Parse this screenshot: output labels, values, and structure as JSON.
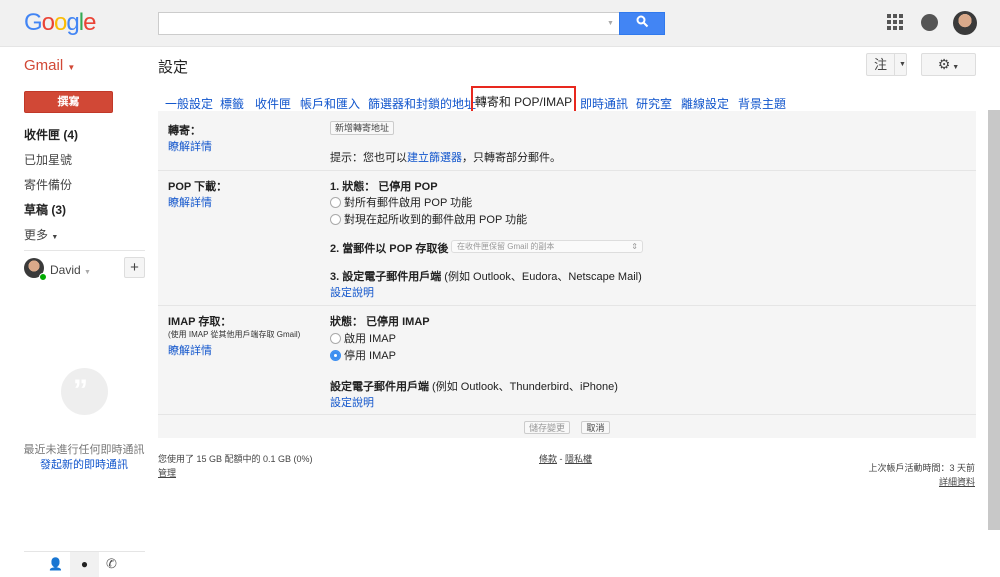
{
  "header": {
    "logo": "Google",
    "search_placeholder": "",
    "apps_icon": "apps-grid-icon",
    "notifications_icon": "bell-icon"
  },
  "subheader": {
    "app": "Gmail",
    "title": "設定",
    "input_tool": "注",
    "settings_icon": "gear-icon"
  },
  "sidebar": {
    "compose": "撰寫",
    "items": [
      {
        "label": "收件匣 (4)",
        "bold": true
      },
      {
        "label": "已加星號"
      },
      {
        "label": "寄件備份"
      },
      {
        "label": "草稿 (3)",
        "bold": true
      },
      {
        "label": "更多"
      }
    ],
    "user": "David",
    "hangouts_empty": "最近未進行任何即時通訊",
    "hangouts_start": "發起新的即時通訊"
  },
  "tabs": [
    "一般設定",
    "標籤",
    "收件匣",
    "帳戶和匯入",
    "篩選器和封鎖的地址",
    "轉寄和 POP/IMAP",
    "即時通訊",
    "研究室",
    "離線設定",
    "背景主題"
  ],
  "forwarding": {
    "label": "轉寄：",
    "learn": "瞭解詳情",
    "add_button": "新增轉寄地址",
    "tip_prefix": "提示：您也可以",
    "tip_link": "建立篩選器",
    "tip_suffix": "，只轉寄部分郵件。"
  },
  "pop": {
    "label": "POP 下載：",
    "learn": "瞭解詳情",
    "status": "1. 狀態： 已停用 POP",
    "opt1": "對所有郵件啟用 POP 功能",
    "opt2": "對現在起所收到的郵件啟用 POP 功能",
    "step2": "2. 當郵件以 POP 存取後",
    "step2_value": "在收件匣保留 Gmail 的副本",
    "step3_bold": "3. 設定電子郵件用戶端",
    "step3_rest": " (例如 Outlook、Eudora、Netscape Mail)",
    "instructions": "設定說明"
  },
  "imap": {
    "label": "IMAP 存取：",
    "sublabel": "(使用 IMAP 從其他用戶端存取 Gmail)",
    "learn": "瞭解詳情",
    "status": "狀態： 已停用 IMAP",
    "opt_enable": "啟用 IMAP",
    "opt_disable": "停用 IMAP",
    "selected": "停用 IMAP",
    "client_bold": "設定電子郵件用戶端",
    "client_rest": " (例如 Outlook、Thunderbird、iPhone)",
    "instructions": "設定說明"
  },
  "actions": {
    "save": "儲存變更",
    "cancel": "取消"
  },
  "footer": {
    "quota": "您使用了 15 GB 配額中的 0.1 GB (0%)",
    "manage": "管理",
    "terms": "條款",
    "sep": " - ",
    "privacy": "隱私權",
    "last_activity": "上次帳戶活動時間：3 天前",
    "details": "詳細資料"
  }
}
